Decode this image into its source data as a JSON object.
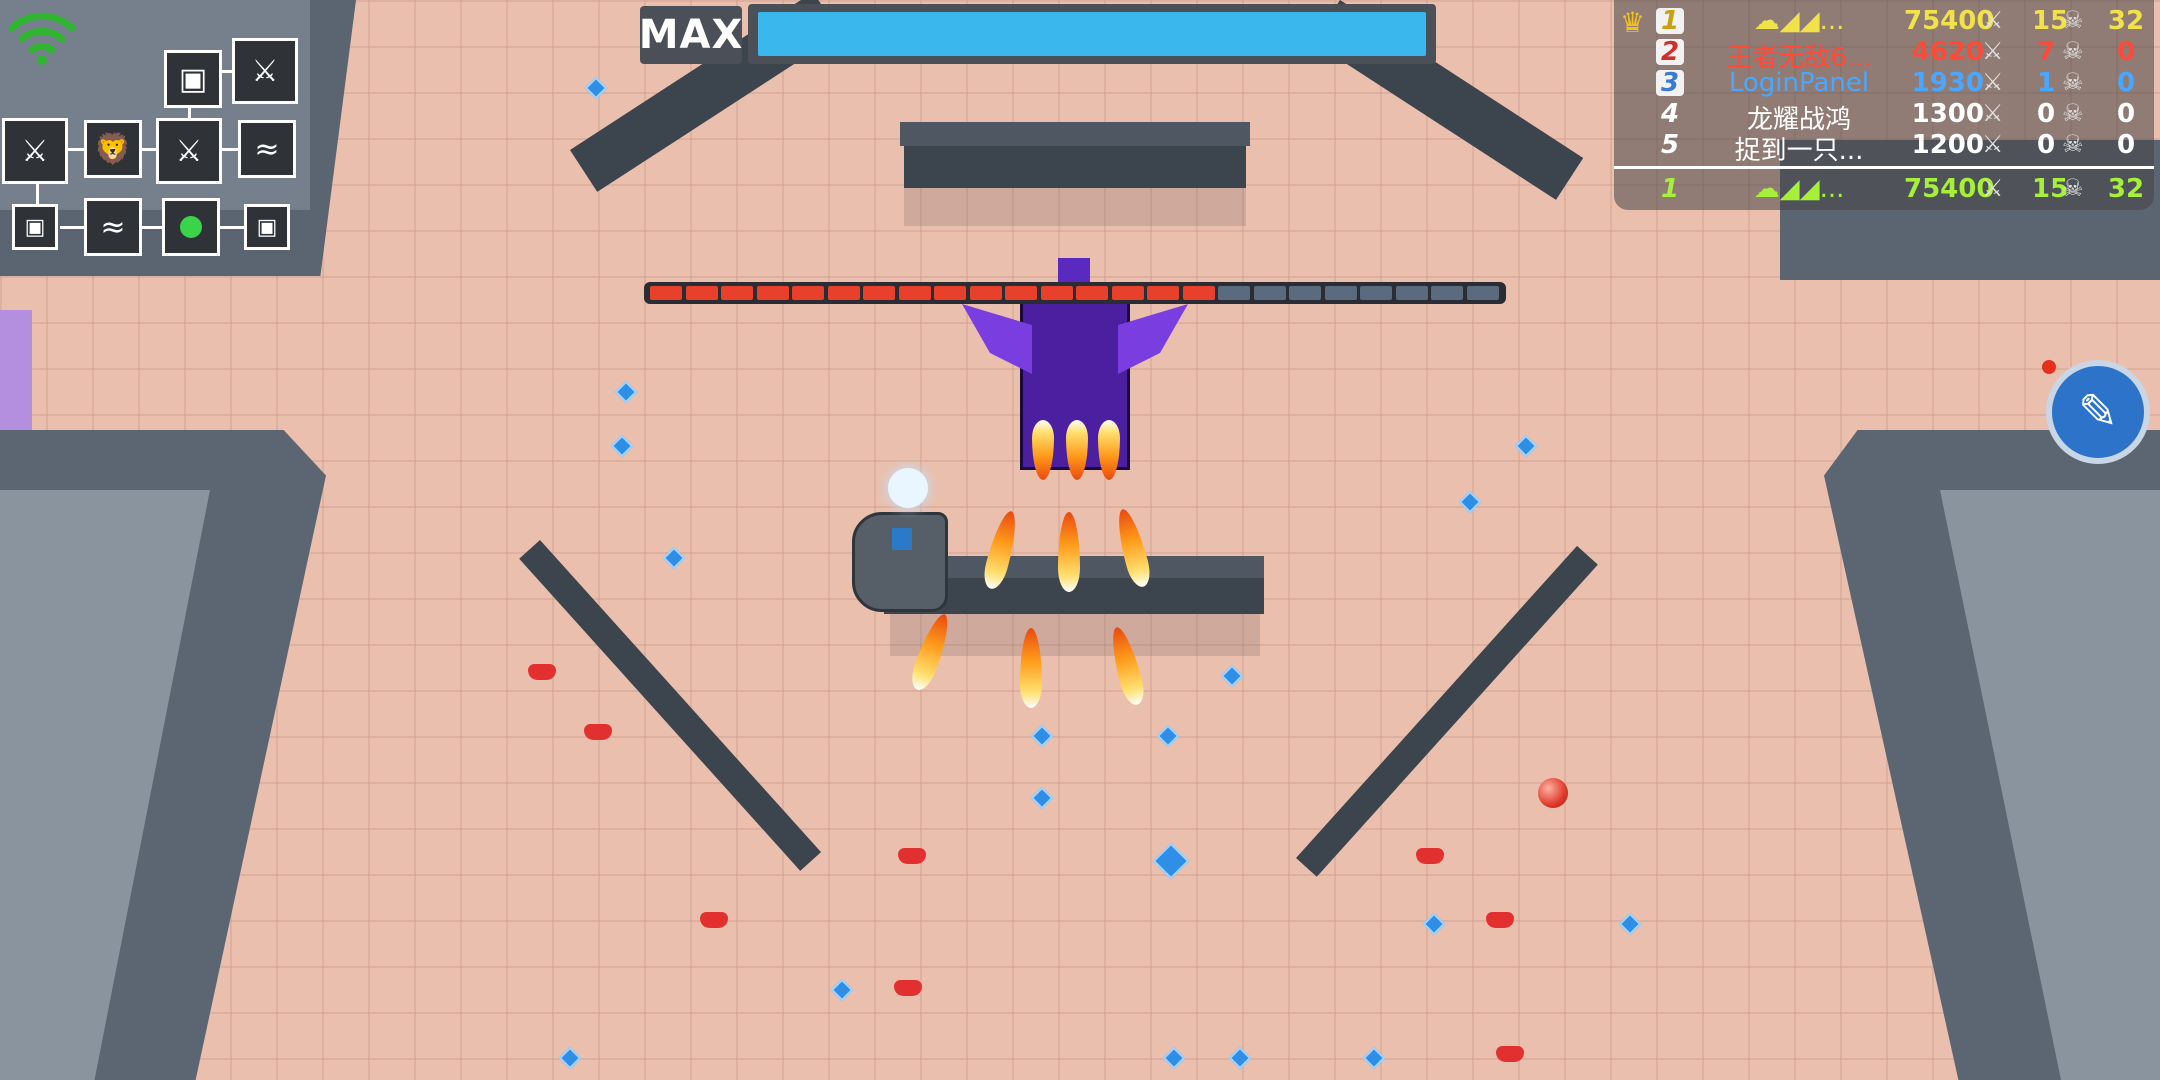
{
  "hud": {
    "max_label": "MAX",
    "xp_fill_fraction": 1.0
  },
  "leaderboard": {
    "rows": [
      {
        "rank": "1",
        "name": "☁◢◢...",
        "score": "75400",
        "kills": "15",
        "dragons": "32",
        "color": "#f2e24a"
      },
      {
        "rank": "2",
        "name": "王者无敌6...",
        "score": "4620",
        "kills": "7",
        "dragons": "0",
        "color": "#ff4a3a"
      },
      {
        "rank": "3",
        "name": "LoginPanel",
        "score": "1930",
        "kills": "1",
        "dragons": "0",
        "color": "#4aa7ff"
      },
      {
        "rank": "4",
        "name": "龙耀战鸿",
        "score": "1300",
        "kills": "0",
        "dragons": "0",
        "color": "#ffffff"
      },
      {
        "rank": "5",
        "name": "捉到一只...",
        "score": "1200",
        "kills": "0",
        "dragons": "0",
        "color": "#ffffff"
      }
    ],
    "self": {
      "rank": "1",
      "name": "☁◢◢...",
      "score": "75400",
      "kills": "15",
      "dragons": "32",
      "color": "#a6f03a"
    }
  },
  "boss": {
    "health_fraction": 0.65,
    "segments": 24
  },
  "icons": {
    "wifi": "wifi-icon",
    "crown": "crown-icon",
    "edit": "brush-icon"
  },
  "colors": {
    "xp_bar": "#3ab8ee",
    "boss_hp": "#e8402a",
    "boss_hp_empty": "#5a6b80"
  }
}
